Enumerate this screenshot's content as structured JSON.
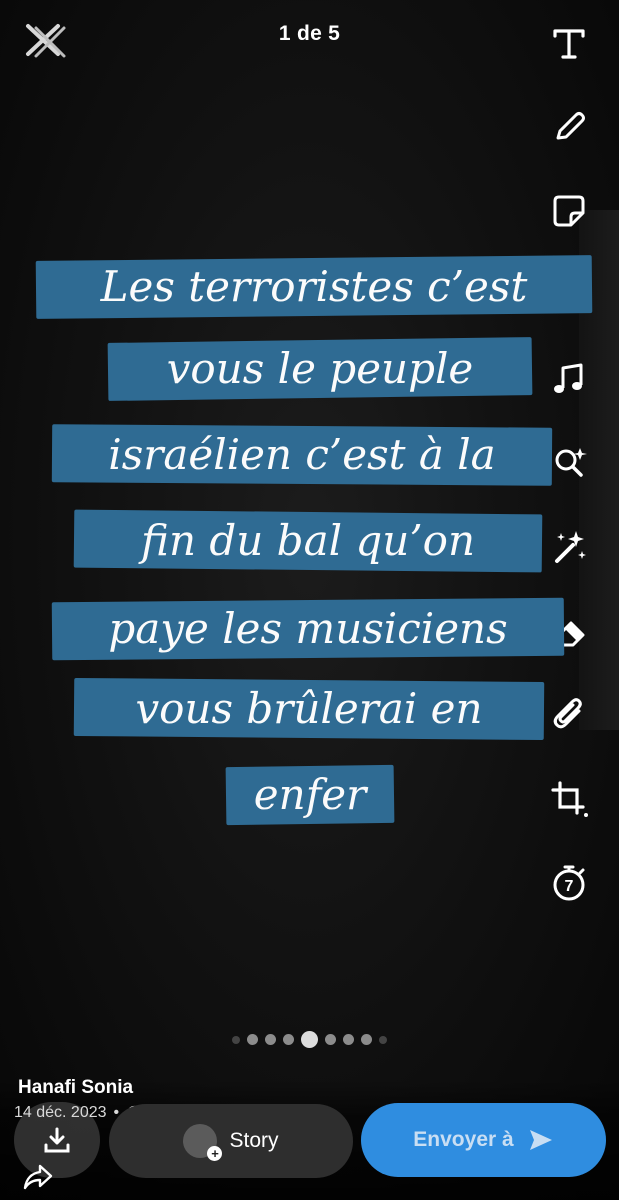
{
  "header": {
    "counter": "1 de 5"
  },
  "caption": {
    "lines": [
      "Les terroristes c’est",
      "vous le peuple",
      "israélien c’est à la",
      "fin du bal qu’on",
      "paye les musiciens",
      "vous brûlerai en",
      "enfer"
    ],
    "highlight_color": "#2f6b93"
  },
  "toolbar": {
    "icons": [
      "text-icon",
      "pencil-icon",
      "sticker-icon",
      "scissors-icon",
      "music-icon",
      "lens-icon",
      "magic-wand-icon",
      "eraser-icon",
      "paperclip-icon",
      "crop-icon",
      "timer-icon"
    ],
    "timer_value": "7"
  },
  "pager": {
    "total_visible": 8,
    "active_index": 3
  },
  "footer": {
    "author": "Hanafi Sonia",
    "date": "14 déc. 2023",
    "separator": "•",
    "story_label": "Story",
    "send_label": "Envoyer à",
    "send_color": "#2f8de0"
  }
}
